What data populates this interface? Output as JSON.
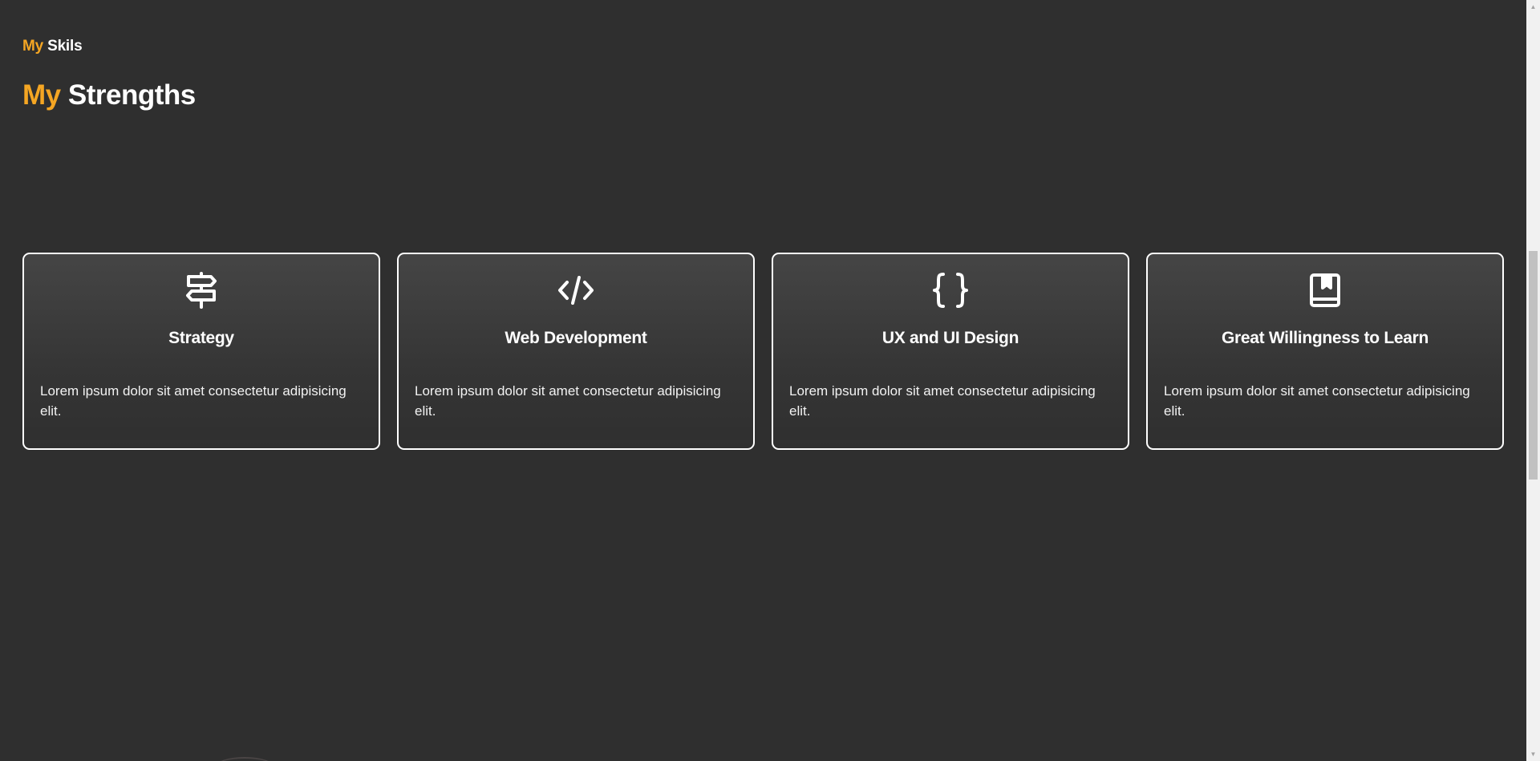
{
  "header": {
    "eyebrow_accent": "My",
    "eyebrow_rest": "Skils",
    "title_accent": "My",
    "title_rest": "Strengths"
  },
  "colors": {
    "accent": "#f5a623",
    "background": "#2f2f2f",
    "text": "#ffffff"
  },
  "cards": [
    {
      "icon": "signpost-icon",
      "title": "Strategy",
      "text": "Lorem ipsum dolor sit amet consectetur adipisicing elit."
    },
    {
      "icon": "code-icon",
      "title": "Web Development",
      "text": "Lorem ipsum dolor sit amet consectetur adipisicing elit."
    },
    {
      "icon": "curly-braces-icon",
      "title": "UX and UI Design",
      "text": "Lorem ipsum dolor sit amet consectetur adipisicing elit."
    },
    {
      "icon": "book-icon",
      "title": "Great Willingness to Learn",
      "text": "Lorem ipsum dolor sit amet consectetur adipisicing elit."
    }
  ]
}
